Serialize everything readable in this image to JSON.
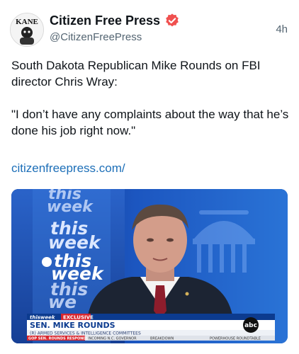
{
  "account": {
    "display_name": "Citizen Free Press",
    "handle": "@CitizenFreePress",
    "avatar_text": "KANE"
  },
  "post": {
    "timestamp": "4h",
    "lines": [
      "South Dakota Republican Mike Rounds on FBI director Chris Wray:",
      "\"I don’t have any complaints about the way that he’s done his job right now.\""
    ],
    "link_text": "citizenfreepress.com/"
  },
  "video": {
    "wall_text": [
      "this",
      "week",
      "this",
      "week",
      "this",
      "week",
      "this",
      "we"
    ],
    "chyron": {
      "show": "thisweek",
      "tag": "EXCLUSIVE",
      "name": "SEN. MIKE ROUNDS",
      "title": "(R) ARMED SERVICES & INTELLIGENCE COMMITTEES",
      "ticker": [
        "GOP SEN. ROUNDS RESPONDS",
        "INCOMING N.C. GOVERNOR",
        "BREAKDOWN",
        "POWERHOUSE ROUNDTABLE"
      ],
      "network": "abc"
    }
  },
  "colors": {
    "verified": "#f0504f",
    "link": "#1d6fb8",
    "muted": "#536471",
    "chyron_blue": "#0c3b8f",
    "chyron_red": "#d7262e"
  }
}
